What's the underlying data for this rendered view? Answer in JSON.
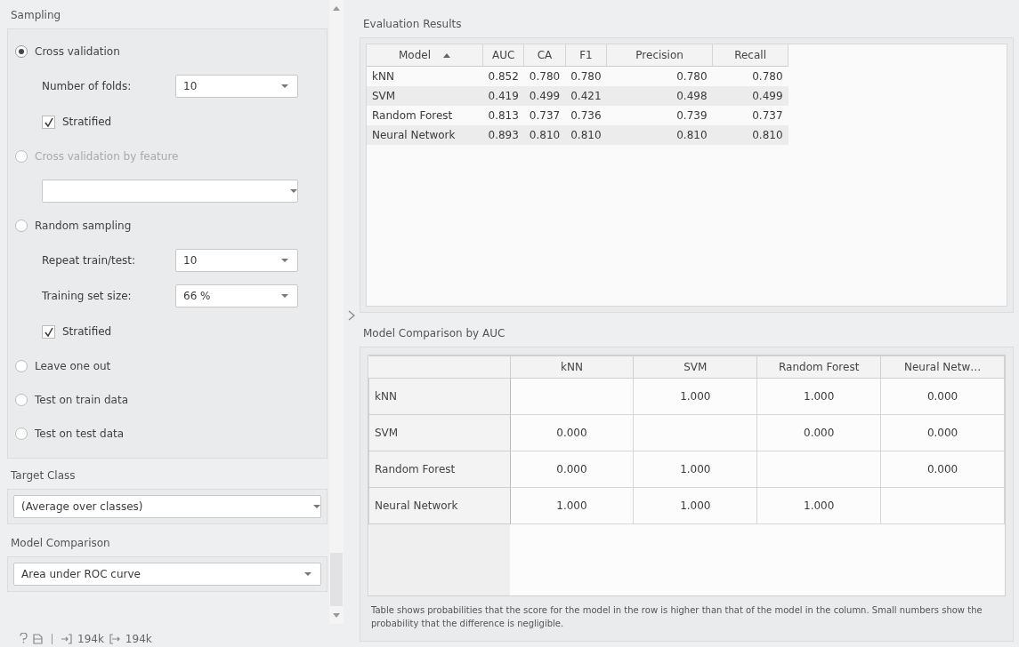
{
  "sampling": {
    "title": "Sampling",
    "options": [
      {
        "label": "Cross validation",
        "selected": true,
        "disabled": false,
        "settings": [
          {
            "kind": "combo",
            "label": "Number of folds:",
            "value": "10"
          },
          {
            "kind": "checkbox",
            "label": "Stratified",
            "checked": true
          }
        ]
      },
      {
        "label": "Cross validation by feature",
        "selected": false,
        "disabled": true,
        "settings": [
          {
            "kind": "combo-wide"
          }
        ]
      },
      {
        "label": "Random sampling",
        "selected": false,
        "disabled": false,
        "settings": [
          {
            "kind": "combo",
            "label": "Repeat train/test:",
            "value": "10"
          },
          {
            "kind": "combo",
            "label": "Training set size:",
            "value": "66 %"
          },
          {
            "kind": "checkbox",
            "label": "Stratified",
            "checked": true
          }
        ]
      },
      {
        "label": "Leave one out",
        "selected": false,
        "disabled": false
      },
      {
        "label": "Test on train data",
        "selected": false,
        "disabled": false
      },
      {
        "label": "Test on test data",
        "selected": false,
        "disabled": false
      }
    ]
  },
  "target_class": {
    "title": "Target Class",
    "value": "(Average over classes)"
  },
  "model_comparison": {
    "title": "Model Comparison",
    "value": "Area under ROC curve"
  },
  "evaluation": {
    "title": "Evaluation Results",
    "columns": [
      {
        "label": "Model",
        "sorted": true
      },
      {
        "label": "AUC",
        "sorted": false
      },
      {
        "label": "CA",
        "sorted": false
      },
      {
        "label": "F1",
        "sorted": false
      },
      {
        "label": "Precision",
        "sorted": false
      },
      {
        "label": "Recall",
        "sorted": false
      }
    ],
    "rows": [
      {
        "cells": [
          "kNN",
          "0.852",
          "0.780",
          "0.780",
          "0.780",
          "0.780"
        ]
      },
      {
        "cells": [
          "SVM",
          "0.419",
          "0.499",
          "0.421",
          "0.498",
          "0.499"
        ]
      },
      {
        "cells": [
          "Random Forest",
          "0.813",
          "0.737",
          "0.736",
          "0.739",
          "0.737"
        ]
      },
      {
        "cells": [
          "Neural Network",
          "0.893",
          "0.810",
          "0.810",
          "0.810",
          "0.810"
        ]
      }
    ]
  },
  "comparison": {
    "title": "Model Comparison by AUC",
    "columns": [
      "kNN",
      "SVM",
      "Random Forest",
      "Neural Netw…"
    ],
    "rows": [
      {
        "label": "kNN",
        "cells": [
          null,
          "1.000",
          "1.000",
          "0.000"
        ]
      },
      {
        "label": "SVM",
        "cells": [
          "0.000",
          null,
          "0.000",
          "0.000"
        ]
      },
      {
        "label": "Random Forest",
        "cells": [
          "0.000",
          "1.000",
          null,
          "0.000"
        ]
      },
      {
        "label": "Neural Network",
        "cells": [
          "1.000",
          "1.000",
          "1.000",
          null
        ]
      }
    ],
    "note": "Table shows probabilities that the score for the model in the row is higher than that of the model in the column. Small numbers show the probability that the difference is negligible."
  },
  "status_bar": {
    "input": "194k",
    "output": "194k"
  }
}
